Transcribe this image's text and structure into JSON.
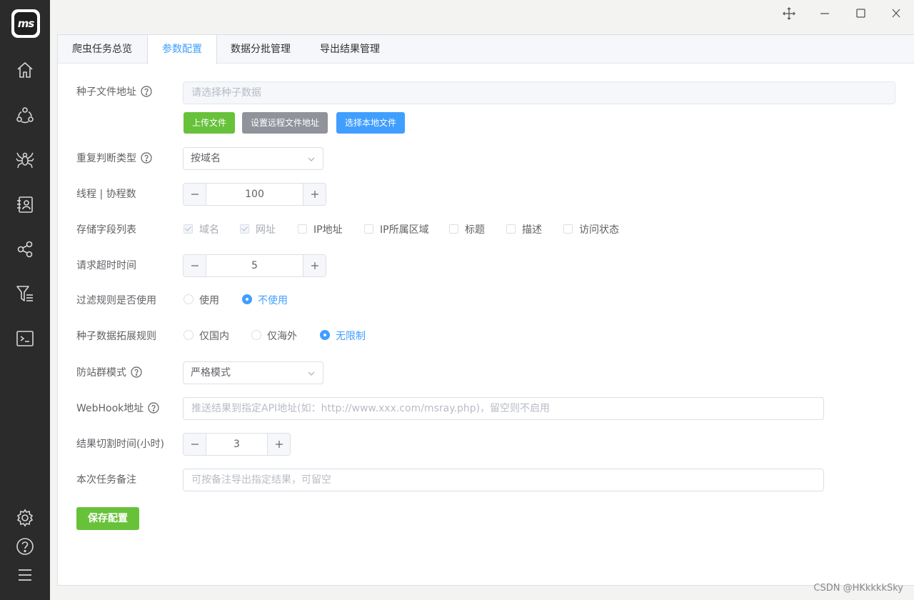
{
  "app": {
    "logo_text": "ms"
  },
  "tabs": [
    {
      "label": "爬虫任务总览"
    },
    {
      "label": "参数配置"
    },
    {
      "label": "数据分批管理"
    },
    {
      "label": "导出结果管理"
    }
  ],
  "form": {
    "seed_file": {
      "label": "种子文件地址",
      "placeholder": "请选择种子数据",
      "upload_btn": "上传文件",
      "remote_btn": "设置远程文件地址",
      "local_btn": "选择本地文件"
    },
    "dup_type": {
      "label": "重复判断类型",
      "value": "按域名"
    },
    "threads": {
      "label": "线程 | 协程数",
      "value": "100"
    },
    "fields": {
      "label": "存储字段列表",
      "options": [
        {
          "label": "域名",
          "checked": true
        },
        {
          "label": "网址",
          "checked": true
        },
        {
          "label": "IP地址",
          "checked": false
        },
        {
          "label": "IP所属区域",
          "checked": false
        },
        {
          "label": "标题",
          "checked": false
        },
        {
          "label": "描述",
          "checked": false
        },
        {
          "label": "访问状态",
          "checked": false
        }
      ]
    },
    "timeout": {
      "label": "请求超时时间",
      "value": "5"
    },
    "filter_rule": {
      "label": "过滤规则是否使用",
      "options": [
        {
          "label": "使用"
        },
        {
          "label": "不使用"
        }
      ],
      "selected": "不使用"
    },
    "expand_rule": {
      "label": "种子数据拓展规则",
      "options": [
        {
          "label": "仅国内"
        },
        {
          "label": "仅海外"
        },
        {
          "label": "无限制"
        }
      ],
      "selected": "无限制"
    },
    "anti_mode": {
      "label": "防站群模式",
      "value": "严格模式"
    },
    "webhook": {
      "label": "WebHook地址",
      "placeholder": "推送结果到指定API地址(如：http://www.xxx.com/msray.php)，留空则不启用"
    },
    "cut_time": {
      "label": "结果切割时间(小时)",
      "value": "3"
    },
    "remark": {
      "label": "本次任务备注",
      "placeholder": "可按备注导出指定结果，可留空"
    },
    "save_label": "保存配置"
  },
  "watermark": "CSDN @HKkkkkSky",
  "colors": {
    "primary": "#409eff",
    "success": "#67c23a",
    "info": "#909399",
    "sidebar": "#2b2b2b"
  },
  "icons": [
    "home-icon",
    "cluster-icon",
    "spider-icon",
    "contacts-icon",
    "share-icon",
    "filter-icon",
    "terminal-icon",
    "settings-icon",
    "help-icon",
    "menu-icon"
  ]
}
